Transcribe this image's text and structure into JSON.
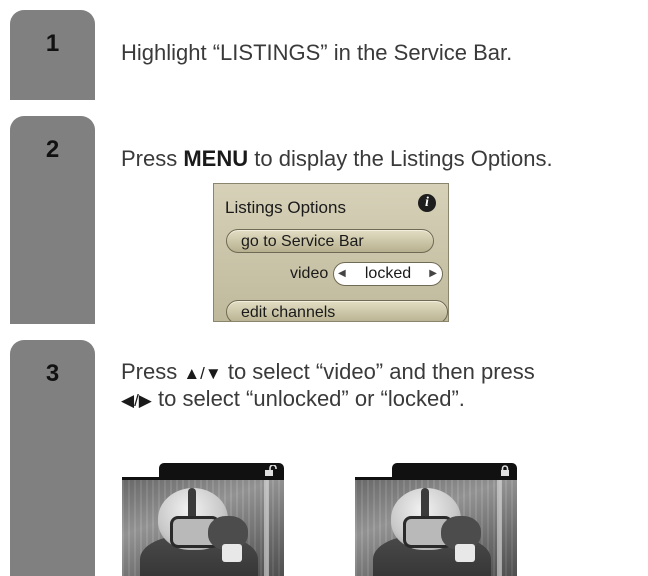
{
  "steps": [
    {
      "number": "1",
      "text": "Highlight “LISTINGS” in the Service Bar."
    },
    {
      "number": "2",
      "text_pre": "Press ",
      "text_bold": "MENU",
      "text_post": " to display the Listings Options."
    },
    {
      "number": "3",
      "line1_pre": "Press ",
      "line1_arrows": "▲/▼",
      "line1_post": " to select “video” and then press",
      "line2_arrows": "◀/▶",
      "line2_post": " to select “unlocked” or “locked”."
    }
  ],
  "listings_menu": {
    "title": "Listings Options",
    "info_icon": "i",
    "item_service_bar": "go to Service Bar",
    "video_label": "video",
    "video_value": "locked",
    "item_edit_channels": "edit channels"
  },
  "screens": [
    {
      "state": "unlocked",
      "icon": "unlocked-padlock-icon"
    },
    {
      "state": "locked",
      "icon": "locked-padlock-icon"
    }
  ],
  "colors": {
    "step_tab": "#808080",
    "menu_background": "#cfc9ad",
    "text": "#3a3a3a"
  }
}
